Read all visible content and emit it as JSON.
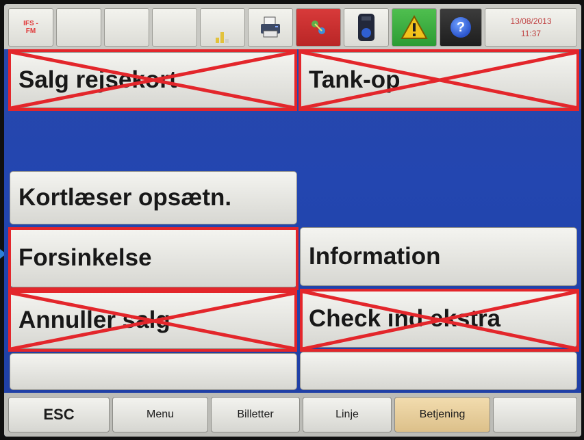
{
  "statusbar": {
    "ifs_label": "IFS -\nFM",
    "date": "13/08/2013",
    "time": "11:37",
    "icons": [
      "ifs-fm-icon",
      "signal-strength-icon",
      "printer-icon",
      "network-icon",
      "card-reader-icon",
      "warning-icon",
      "help-icon"
    ]
  },
  "menu": {
    "salg_rejsekort": "Salg rejsekort",
    "tank_op": "Tank-op",
    "kortlaeser": "Kortlæser opsætn.",
    "forsinkelse": "Forsinkelse",
    "information": "Information",
    "annuller_salg": "Annuller salg",
    "check_ind_ekstra": "Check ind ekstra"
  },
  "bottombar": {
    "esc": "ESC",
    "menu": "Menu",
    "billetter": "Billetter",
    "linje": "Linje",
    "betjening": "Betjening"
  },
  "colors": {
    "highlight_red": "#e3262b",
    "screen_blue": "#2346b0",
    "active_tab": "#e8cf9c"
  }
}
